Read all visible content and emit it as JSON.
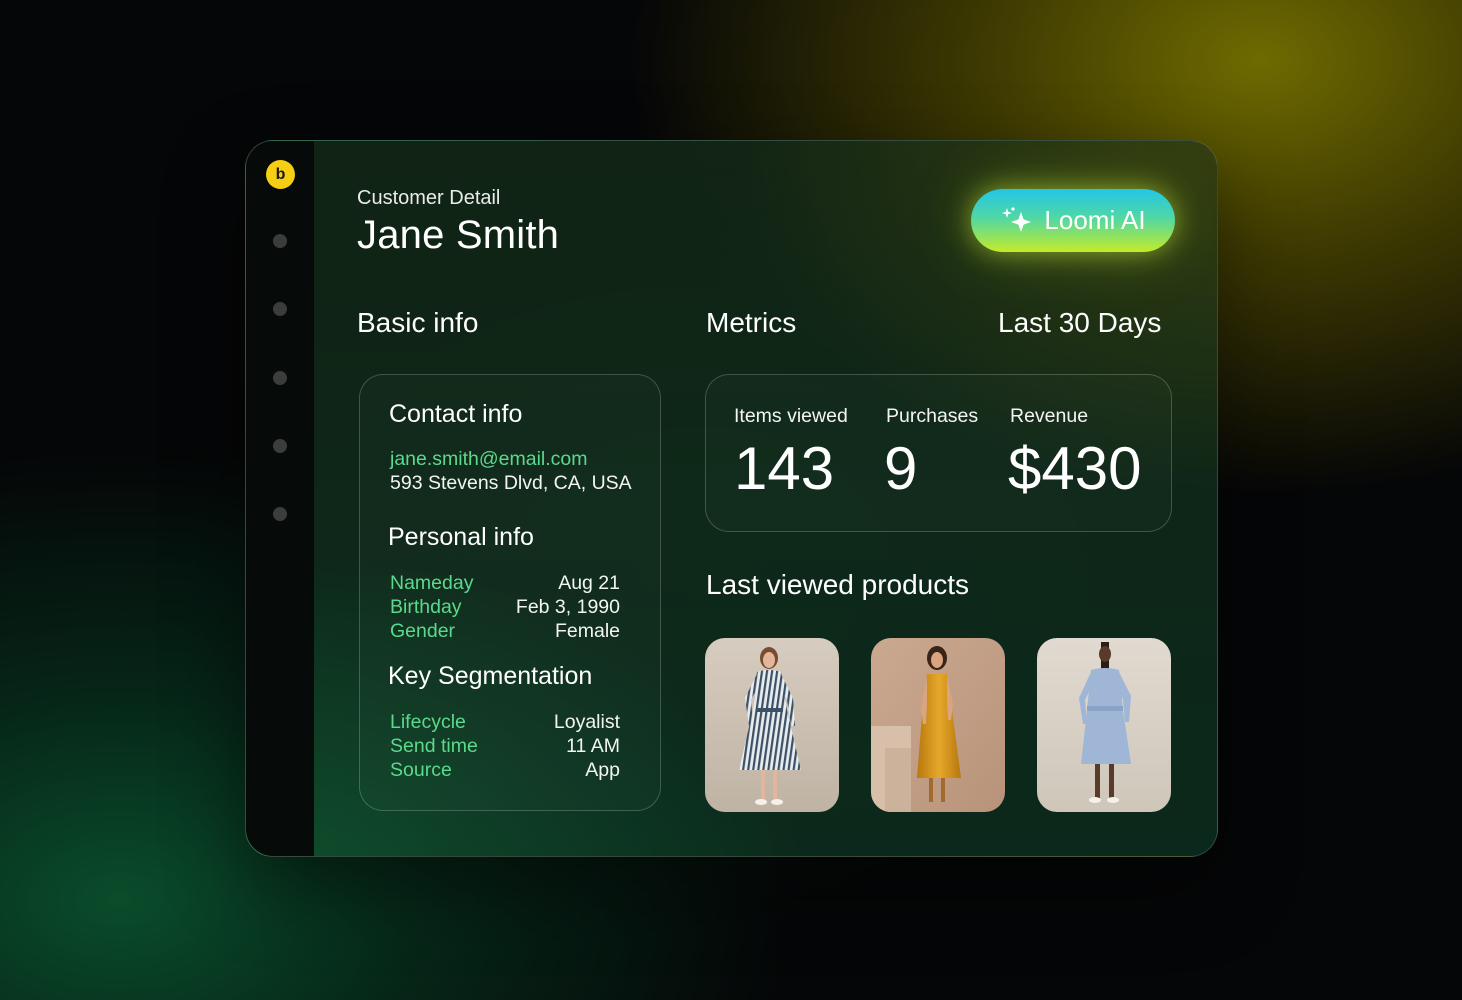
{
  "header": {
    "breadcrumb": "Customer Detail",
    "customer_name": "Jane Smith",
    "ai_button_label": "Loomi AI"
  },
  "sidebar": {
    "logo_glyph": "b",
    "logo_color": "#f6cf12",
    "nav_items": [
      "nav-dot",
      "nav-dot",
      "nav-dot",
      "nav-dot",
      "nav-dot"
    ]
  },
  "basic_info": {
    "heading": "Basic info",
    "contact": {
      "heading": "Contact info",
      "email": "jane.smith@email.com",
      "address": "593 Stevens Dlvd, CA, USA"
    },
    "personal": {
      "heading": "Personal info",
      "rows": [
        {
          "label": "Nameday",
          "value": "Aug 21"
        },
        {
          "label": "Birthday",
          "value": "Feb 3, 1990"
        },
        {
          "label": "Gender",
          "value": "Female"
        }
      ]
    },
    "segmentation": {
      "heading": "Key Segmentation",
      "rows": [
        {
          "label": "Lifecycle",
          "value": "Loyalist"
        },
        {
          "label": "Send time",
          "value": "11 AM"
        },
        {
          "label": "Source",
          "value": "App"
        }
      ]
    }
  },
  "metrics": {
    "heading": "Metrics",
    "period": "Last 30 Days",
    "items": [
      {
        "label": "Items viewed",
        "value": "143"
      },
      {
        "label": "Purchases",
        "value": "9"
      },
      {
        "label": "Revenue",
        "value": "$430"
      }
    ]
  },
  "products": {
    "heading": "Last viewed products",
    "items": [
      {
        "name": "striped-shirt-dress",
        "dress_color": "#cfd6dc",
        "bg_color": "#cbbfb1"
      },
      {
        "name": "yellow-satin-slip-dress",
        "dress_color": "#d99a1e",
        "bg_color": "#c9a88f"
      },
      {
        "name": "blue-chambray-shirt-dress",
        "dress_color": "#9fb6d6",
        "bg_color": "#d9d2c8"
      }
    ]
  },
  "colors": {
    "accent_green": "#5bd98c",
    "ai_gradient_start": "#22c6e6",
    "ai_gradient_end": "#c4eb2a"
  }
}
